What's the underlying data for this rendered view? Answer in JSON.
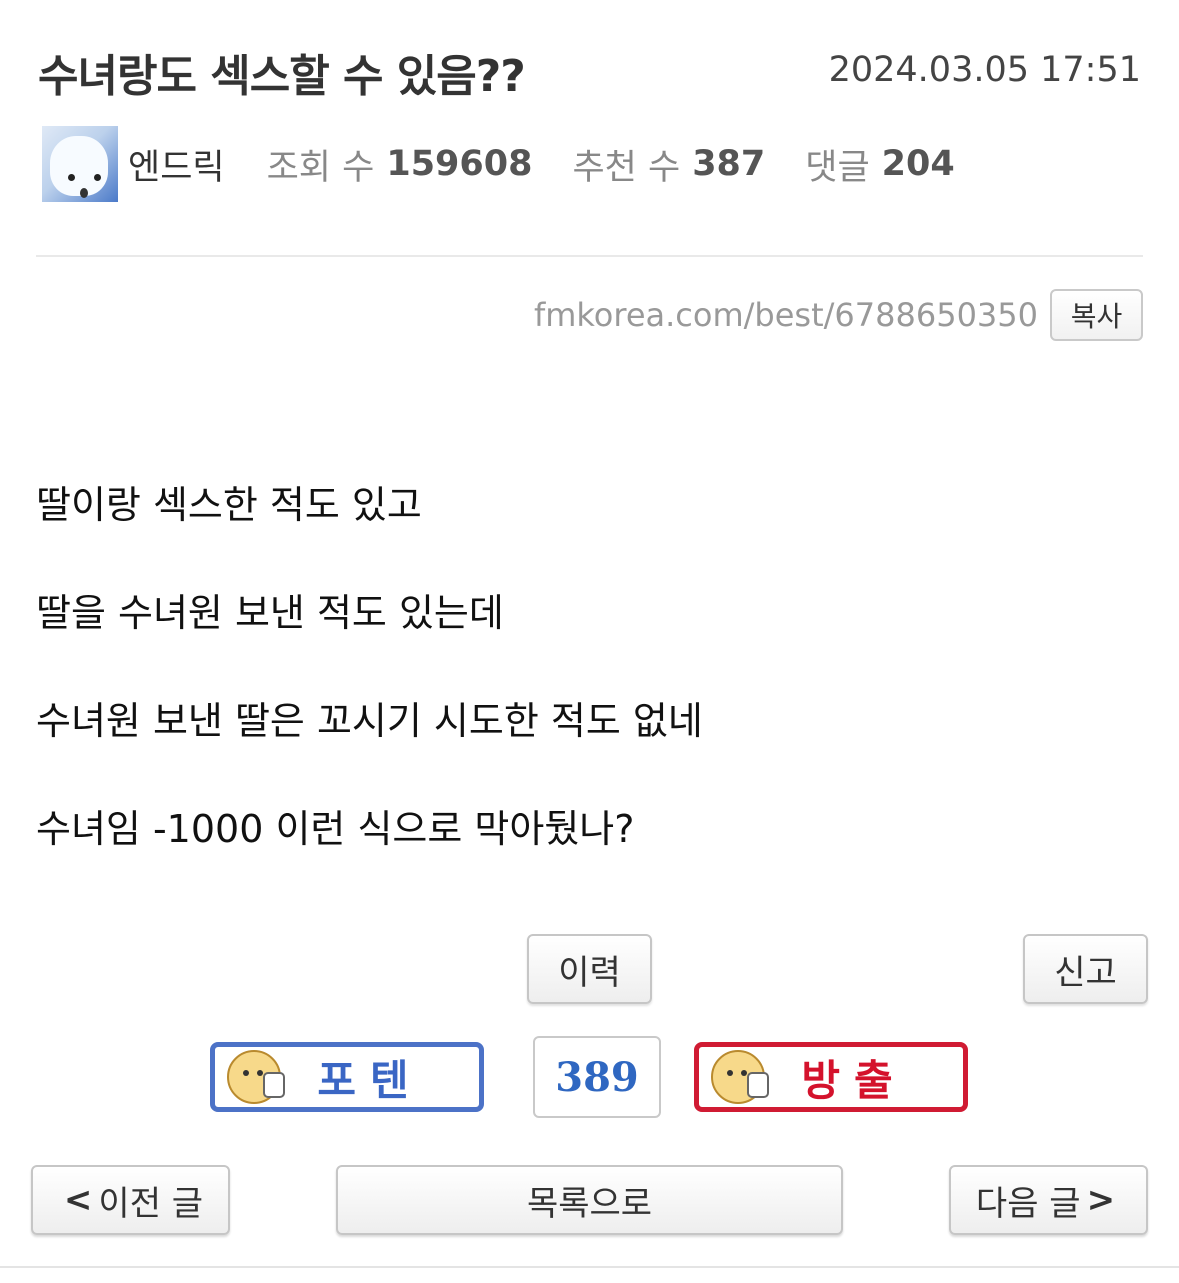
{
  "post": {
    "title": "수녀랑도 섹스할 수 있음??",
    "date": "2024.03.05 17:51",
    "author": "엔드릭",
    "views_label": "조회 수",
    "views": "159608",
    "recommend_label": "추천 수",
    "recommend": "387",
    "comments_label": "댓글",
    "comments": "204",
    "url": "fmkorea.com/best/6788650350",
    "copy_label": "복사",
    "body": [
      "딸이랑 섹스한 적도 있고",
      "딸을 수녀원 보낸 적도 있는데",
      "수녀원 보낸 딸은 꼬시기 시도한 적도 없네",
      "수녀임 -1000 이런 식으로 막아뒀나?"
    ]
  },
  "actions": {
    "history_label": "이력",
    "report_label": "신고",
    "upvote_label": "포텐",
    "vote_count": "389",
    "downvote_label": "방출"
  },
  "nav": {
    "prev_label": "이전 글",
    "list_label": "목록으로",
    "next_label": "다음 글",
    "prev_chevron": "<",
    "next_chevron": ">"
  },
  "colors": {
    "upvote": "#4c72c7",
    "downvote": "#d01b33",
    "count": "#2f67c1"
  }
}
